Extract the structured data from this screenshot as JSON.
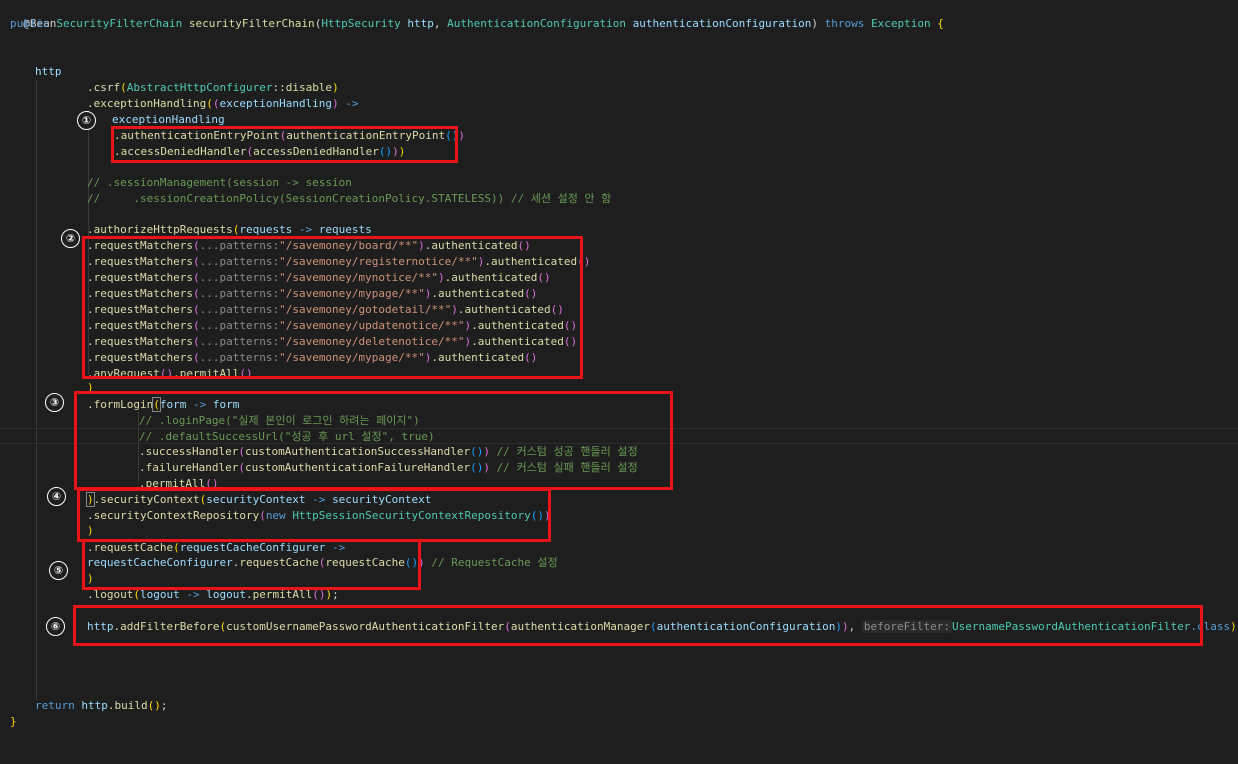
{
  "code": {
    "annotation": "@Bean",
    "signature": {
      "public": "public",
      "return_type": "SecurityFilterChain",
      "method": "securityFilterChain",
      "param1_type": "HttpSecurity",
      "param1": "http",
      "param2_type": "AuthenticationConfiguration",
      "param2": "authenticationConfiguration",
      "throws": "throws",
      "exception": "Exception",
      "open": "{"
    },
    "http": "http",
    "csrf_method": ".csrf",
    "csrf_arg_class": "AbstractHttpConfigurer",
    "csrf_arg_method": "::disable",
    "exception_handling_method": ".exceptionHandling",
    "exception_handling_param": "exceptionHandling",
    "arrow": " ->",
    "exception_handling_obj": "exceptionHandling",
    "auth_entry_method": ".authenticationEntryPoint",
    "auth_entry_arg": "authenticationEntryPoint",
    "access_denied_method": ".accessDeniedHandler",
    "access_denied_arg": "accessDeniedHandler",
    "comment_session_1": "// .sessionManagement(session -> session",
    "comment_session_2": "//     .sessionCreationPolicy(SessionCreationPolicy.STATELESS)) // 세션 설정 안 함",
    "authorize_method": ".authorizeHttpRequests",
    "authorize_param": "requests",
    "authorize_obj": "requests",
    "request_matchers_method": ".requestMatchers",
    "patterns_hint": "...patterns:",
    "authenticated": ".authenticated",
    "request_patterns": [
      "\"/savemoney/board/**\"",
      "\"/savemoney/registernotice/**\"",
      "\"/savemoney/mynotice/**\"",
      "\"/savemoney/mypage/**\"",
      "\"/savemoney/gotodetail/**\"",
      "\"/savemoney/updatenotice/**\"",
      "\"/savemoney/deletenotice/**\"",
      "\"/savemoney/mypage/**\""
    ],
    "any_request": ".anyRequest",
    "permit_all": ".permitAll",
    "close_paren": ")",
    "form_login_method": ".formLogin",
    "form_param": "form",
    "form_obj": "form",
    "comment_login_page": "// .loginPage(\"실제 본인이 로그인 하려는 페이지\")",
    "comment_default_success": "// .defaultSuccessUrl(\"성공 후 url 설정\", true)",
    "success_handler_method": ".successHandler",
    "success_handler_arg": "customAuthenticationSuccessHandler",
    "success_comment": "// 커스텀 성공 핸들러 설정",
    "failure_handler_method": ".failureHandler",
    "failure_handler_arg": "customAuthenticationFailureHandler",
    "failure_comment": "// 커스텀 실패 핸들러 설정",
    "security_context_method": ".securityContext",
    "security_context_param": "securityContext",
    "security_context_obj": "securityContext",
    "security_context_repo_method": ".securityContextRepository",
    "new_kw": "new",
    "http_session_repo": "HttpSessionSecurityContextRepository",
    "request_cache_method": ".requestCache",
    "request_cache_param": "requestCacheConfigurer",
    "request_cache_obj": "requestCacheConfigurer",
    "request_cache_inner": ".requestCache",
    "request_cache_arg": "requestCache",
    "request_cache_comment": "// RequestCache 설정",
    "logout_method": ".logout",
    "logout_param": "logout",
    "logout_obj": "logout",
    "add_filter_method": ".addFilterBefore",
    "custom_filter": "customUsernamePasswordAuthenticationFilter",
    "auth_manager": "authenticationManager",
    "auth_config": "authenticationConfiguration",
    "before_filter_hint": "beforeFilter:",
    "upaf_class": "UsernamePasswordAuthenticationFilter",
    "class_kw": ".class",
    "return_kw": "return",
    "build_method": ".build",
    "close_brace": "}"
  },
  "markers": [
    "①",
    "②",
    "③",
    "④",
    "⑤",
    "⑥"
  ],
  "colors": {
    "highlight": "#e8141a",
    "background": "#1e1e1e"
  }
}
